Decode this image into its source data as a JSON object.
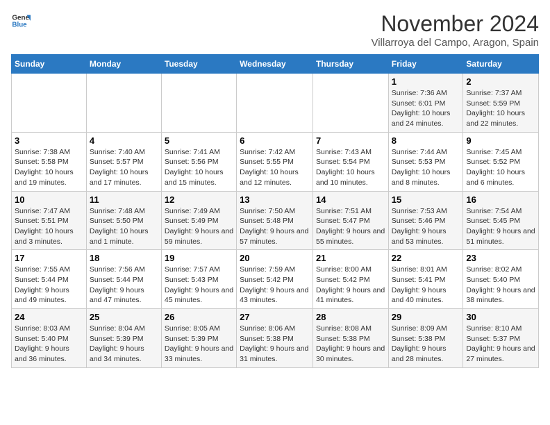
{
  "logo": {
    "text_general": "General",
    "text_blue": "Blue"
  },
  "header": {
    "month": "November 2024",
    "location": "Villarroya del Campo, Aragon, Spain"
  },
  "weekdays": [
    "Sunday",
    "Monday",
    "Tuesday",
    "Wednesday",
    "Thursday",
    "Friday",
    "Saturday"
  ],
  "weeks": [
    [
      {
        "day": "",
        "sunrise": "",
        "sunset": "",
        "daylight": ""
      },
      {
        "day": "",
        "sunrise": "",
        "sunset": "",
        "daylight": ""
      },
      {
        "day": "",
        "sunrise": "",
        "sunset": "",
        "daylight": ""
      },
      {
        "day": "",
        "sunrise": "",
        "sunset": "",
        "daylight": ""
      },
      {
        "day": "",
        "sunrise": "",
        "sunset": "",
        "daylight": ""
      },
      {
        "day": "1",
        "sunrise": "Sunrise: 7:36 AM",
        "sunset": "Sunset: 6:01 PM",
        "daylight": "Daylight: 10 hours and 24 minutes."
      },
      {
        "day": "2",
        "sunrise": "Sunrise: 7:37 AM",
        "sunset": "Sunset: 5:59 PM",
        "daylight": "Daylight: 10 hours and 22 minutes."
      }
    ],
    [
      {
        "day": "3",
        "sunrise": "Sunrise: 7:38 AM",
        "sunset": "Sunset: 5:58 PM",
        "daylight": "Daylight: 10 hours and 19 minutes."
      },
      {
        "day": "4",
        "sunrise": "Sunrise: 7:40 AM",
        "sunset": "Sunset: 5:57 PM",
        "daylight": "Daylight: 10 hours and 17 minutes."
      },
      {
        "day": "5",
        "sunrise": "Sunrise: 7:41 AM",
        "sunset": "Sunset: 5:56 PM",
        "daylight": "Daylight: 10 hours and 15 minutes."
      },
      {
        "day": "6",
        "sunrise": "Sunrise: 7:42 AM",
        "sunset": "Sunset: 5:55 PM",
        "daylight": "Daylight: 10 hours and 12 minutes."
      },
      {
        "day": "7",
        "sunrise": "Sunrise: 7:43 AM",
        "sunset": "Sunset: 5:54 PM",
        "daylight": "Daylight: 10 hours and 10 minutes."
      },
      {
        "day": "8",
        "sunrise": "Sunrise: 7:44 AM",
        "sunset": "Sunset: 5:53 PM",
        "daylight": "Daylight: 10 hours and 8 minutes."
      },
      {
        "day": "9",
        "sunrise": "Sunrise: 7:45 AM",
        "sunset": "Sunset: 5:52 PM",
        "daylight": "Daylight: 10 hours and 6 minutes."
      }
    ],
    [
      {
        "day": "10",
        "sunrise": "Sunrise: 7:47 AM",
        "sunset": "Sunset: 5:51 PM",
        "daylight": "Daylight: 10 hours and 3 minutes."
      },
      {
        "day": "11",
        "sunrise": "Sunrise: 7:48 AM",
        "sunset": "Sunset: 5:50 PM",
        "daylight": "Daylight: 10 hours and 1 minute."
      },
      {
        "day": "12",
        "sunrise": "Sunrise: 7:49 AM",
        "sunset": "Sunset: 5:49 PM",
        "daylight": "Daylight: 9 hours and 59 minutes."
      },
      {
        "day": "13",
        "sunrise": "Sunrise: 7:50 AM",
        "sunset": "Sunset: 5:48 PM",
        "daylight": "Daylight: 9 hours and 57 minutes."
      },
      {
        "day": "14",
        "sunrise": "Sunrise: 7:51 AM",
        "sunset": "Sunset: 5:47 PM",
        "daylight": "Daylight: 9 hours and 55 minutes."
      },
      {
        "day": "15",
        "sunrise": "Sunrise: 7:53 AM",
        "sunset": "Sunset: 5:46 PM",
        "daylight": "Daylight: 9 hours and 53 minutes."
      },
      {
        "day": "16",
        "sunrise": "Sunrise: 7:54 AM",
        "sunset": "Sunset: 5:45 PM",
        "daylight": "Daylight: 9 hours and 51 minutes."
      }
    ],
    [
      {
        "day": "17",
        "sunrise": "Sunrise: 7:55 AM",
        "sunset": "Sunset: 5:44 PM",
        "daylight": "Daylight: 9 hours and 49 minutes."
      },
      {
        "day": "18",
        "sunrise": "Sunrise: 7:56 AM",
        "sunset": "Sunset: 5:44 PM",
        "daylight": "Daylight: 9 hours and 47 minutes."
      },
      {
        "day": "19",
        "sunrise": "Sunrise: 7:57 AM",
        "sunset": "Sunset: 5:43 PM",
        "daylight": "Daylight: 9 hours and 45 minutes."
      },
      {
        "day": "20",
        "sunrise": "Sunrise: 7:59 AM",
        "sunset": "Sunset: 5:42 PM",
        "daylight": "Daylight: 9 hours and 43 minutes."
      },
      {
        "day": "21",
        "sunrise": "Sunrise: 8:00 AM",
        "sunset": "Sunset: 5:42 PM",
        "daylight": "Daylight: 9 hours and 41 minutes."
      },
      {
        "day": "22",
        "sunrise": "Sunrise: 8:01 AM",
        "sunset": "Sunset: 5:41 PM",
        "daylight": "Daylight: 9 hours and 40 minutes."
      },
      {
        "day": "23",
        "sunrise": "Sunrise: 8:02 AM",
        "sunset": "Sunset: 5:40 PM",
        "daylight": "Daylight: 9 hours and 38 minutes."
      }
    ],
    [
      {
        "day": "24",
        "sunrise": "Sunrise: 8:03 AM",
        "sunset": "Sunset: 5:40 PM",
        "daylight": "Daylight: 9 hours and 36 minutes."
      },
      {
        "day": "25",
        "sunrise": "Sunrise: 8:04 AM",
        "sunset": "Sunset: 5:39 PM",
        "daylight": "Daylight: 9 hours and 34 minutes."
      },
      {
        "day": "26",
        "sunrise": "Sunrise: 8:05 AM",
        "sunset": "Sunset: 5:39 PM",
        "daylight": "Daylight: 9 hours and 33 minutes."
      },
      {
        "day": "27",
        "sunrise": "Sunrise: 8:06 AM",
        "sunset": "Sunset: 5:38 PM",
        "daylight": "Daylight: 9 hours and 31 minutes."
      },
      {
        "day": "28",
        "sunrise": "Sunrise: 8:08 AM",
        "sunset": "Sunset: 5:38 PM",
        "daylight": "Daylight: 9 hours and 30 minutes."
      },
      {
        "day": "29",
        "sunrise": "Sunrise: 8:09 AM",
        "sunset": "Sunset: 5:38 PM",
        "daylight": "Daylight: 9 hours and 28 minutes."
      },
      {
        "day": "30",
        "sunrise": "Sunrise: 8:10 AM",
        "sunset": "Sunset: 5:37 PM",
        "daylight": "Daylight: 9 hours and 27 minutes."
      }
    ]
  ]
}
